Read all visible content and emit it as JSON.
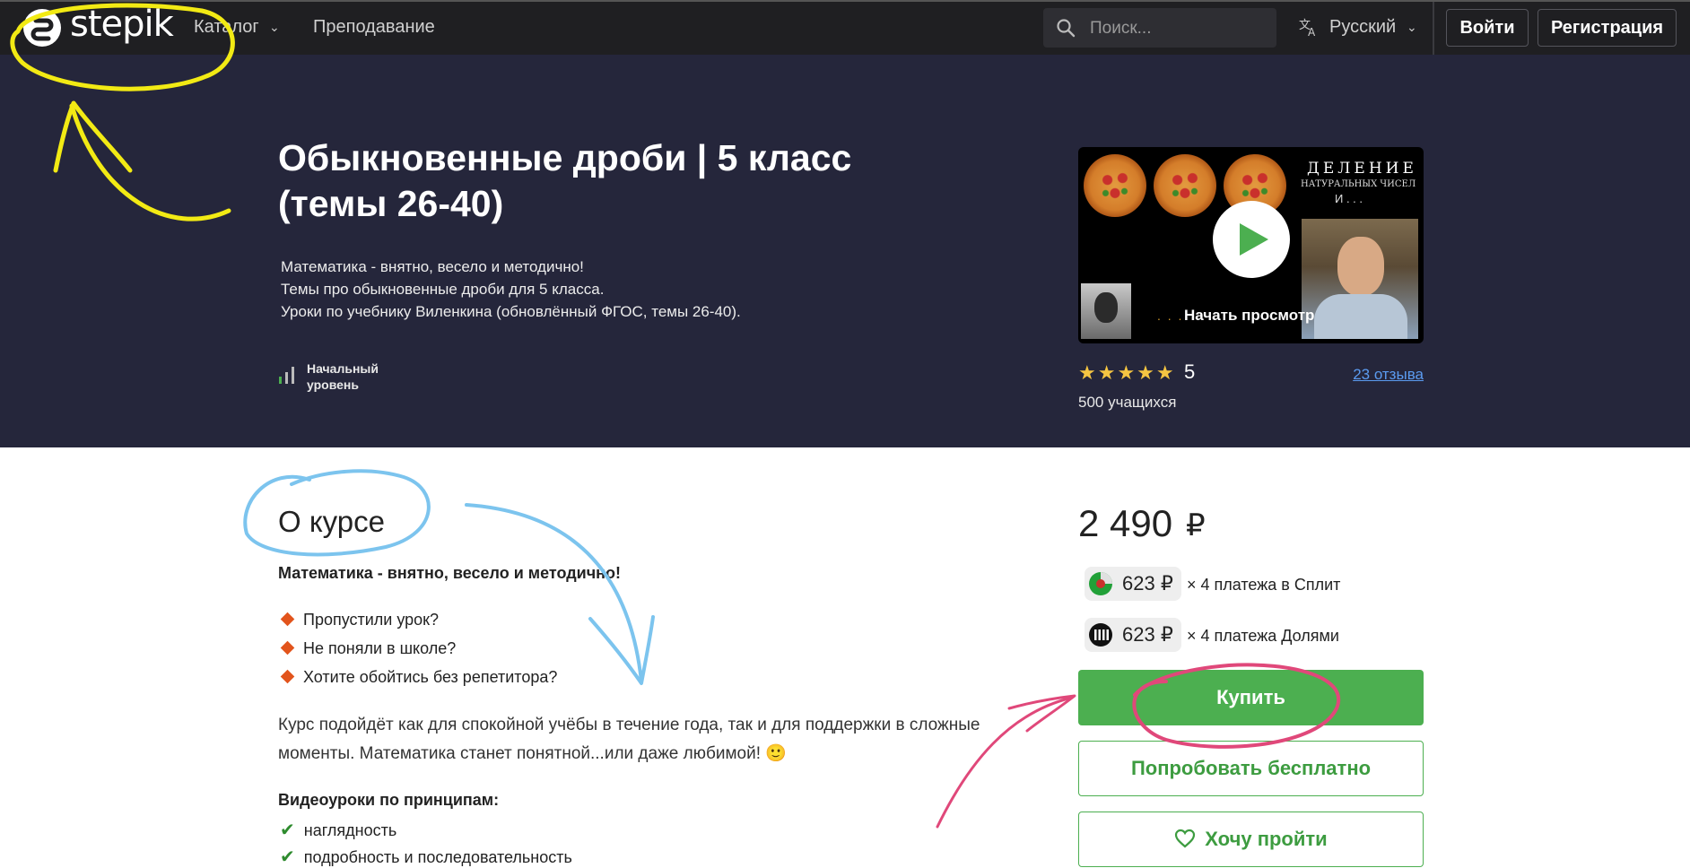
{
  "navbar": {
    "logo_text": "stepik",
    "catalog_label": "Каталог",
    "teaching_label": "Преподавание",
    "search_placeholder": "Поиск...",
    "language_label": "Русский",
    "login_label": "Войти",
    "register_label": "Регистрация"
  },
  "hero": {
    "title": "Обыкновенные дроби | 5 класс (темы 26-40)",
    "description": [
      "Математика - внятно, весело и методично!",
      "Темы про обыкновенные дроби для 5 класса.",
      "Уроки по учебнику Виленкина (обновлённый ФГОС, темы 26-40)."
    ],
    "level": "Начальный уровень",
    "video": {
      "play_label": "Начать просмотр",
      "overlay_title": "ДЕЛЕНИЕ",
      "overlay_subtitle": "НАТУРАЛЬНЫХ ЧИСЕЛ",
      "overlay_tail": "И . . .",
      "dots": ". . ."
    },
    "rating": {
      "stars": "★★★★★",
      "value": "5"
    },
    "reviews_link": "23 отзыва",
    "students": "500 учащихся"
  },
  "about": {
    "title": "О курсе",
    "lead": "Математика - внятно, весело и методично!",
    "questions": [
      "Пропустили урок?",
      "Не поняли в школе?",
      "Хотите обойтись без репетитора?"
    ],
    "paragraph": "Курс подойдёт как для спокойной учёбы в течение года, так и для поддержки в сложные моменты. Математика станет понятной...или даже любимой! 🙂",
    "principles_title": "Видеоуроки по принципам:",
    "principles": [
      "наглядность",
      "подробность и последовательность"
    ]
  },
  "purchase": {
    "price": "2 490",
    "currency": "₽",
    "installments": [
      {
        "amount": "623 ₽",
        "text": "× 4 платежа в Сплит",
        "logo": "split-logo",
        "color": "#21a038"
      },
      {
        "amount": "623 ₽",
        "text": "× 4 платежа Долями",
        "logo": "dolyami-logo",
        "color": "#111111"
      }
    ],
    "buy_label": "Купить",
    "try_free_label": "Попробовать бесплатно",
    "wishlist_label": "Хочу пройти"
  },
  "colors": {
    "hero_bg": "#25263b",
    "accent_green": "#4caf50",
    "link_blue": "#5b9bf0",
    "annotation_yellow": "#f2ea14",
    "annotation_blue": "#7cc4ee",
    "annotation_pink": "#e0487a"
  }
}
